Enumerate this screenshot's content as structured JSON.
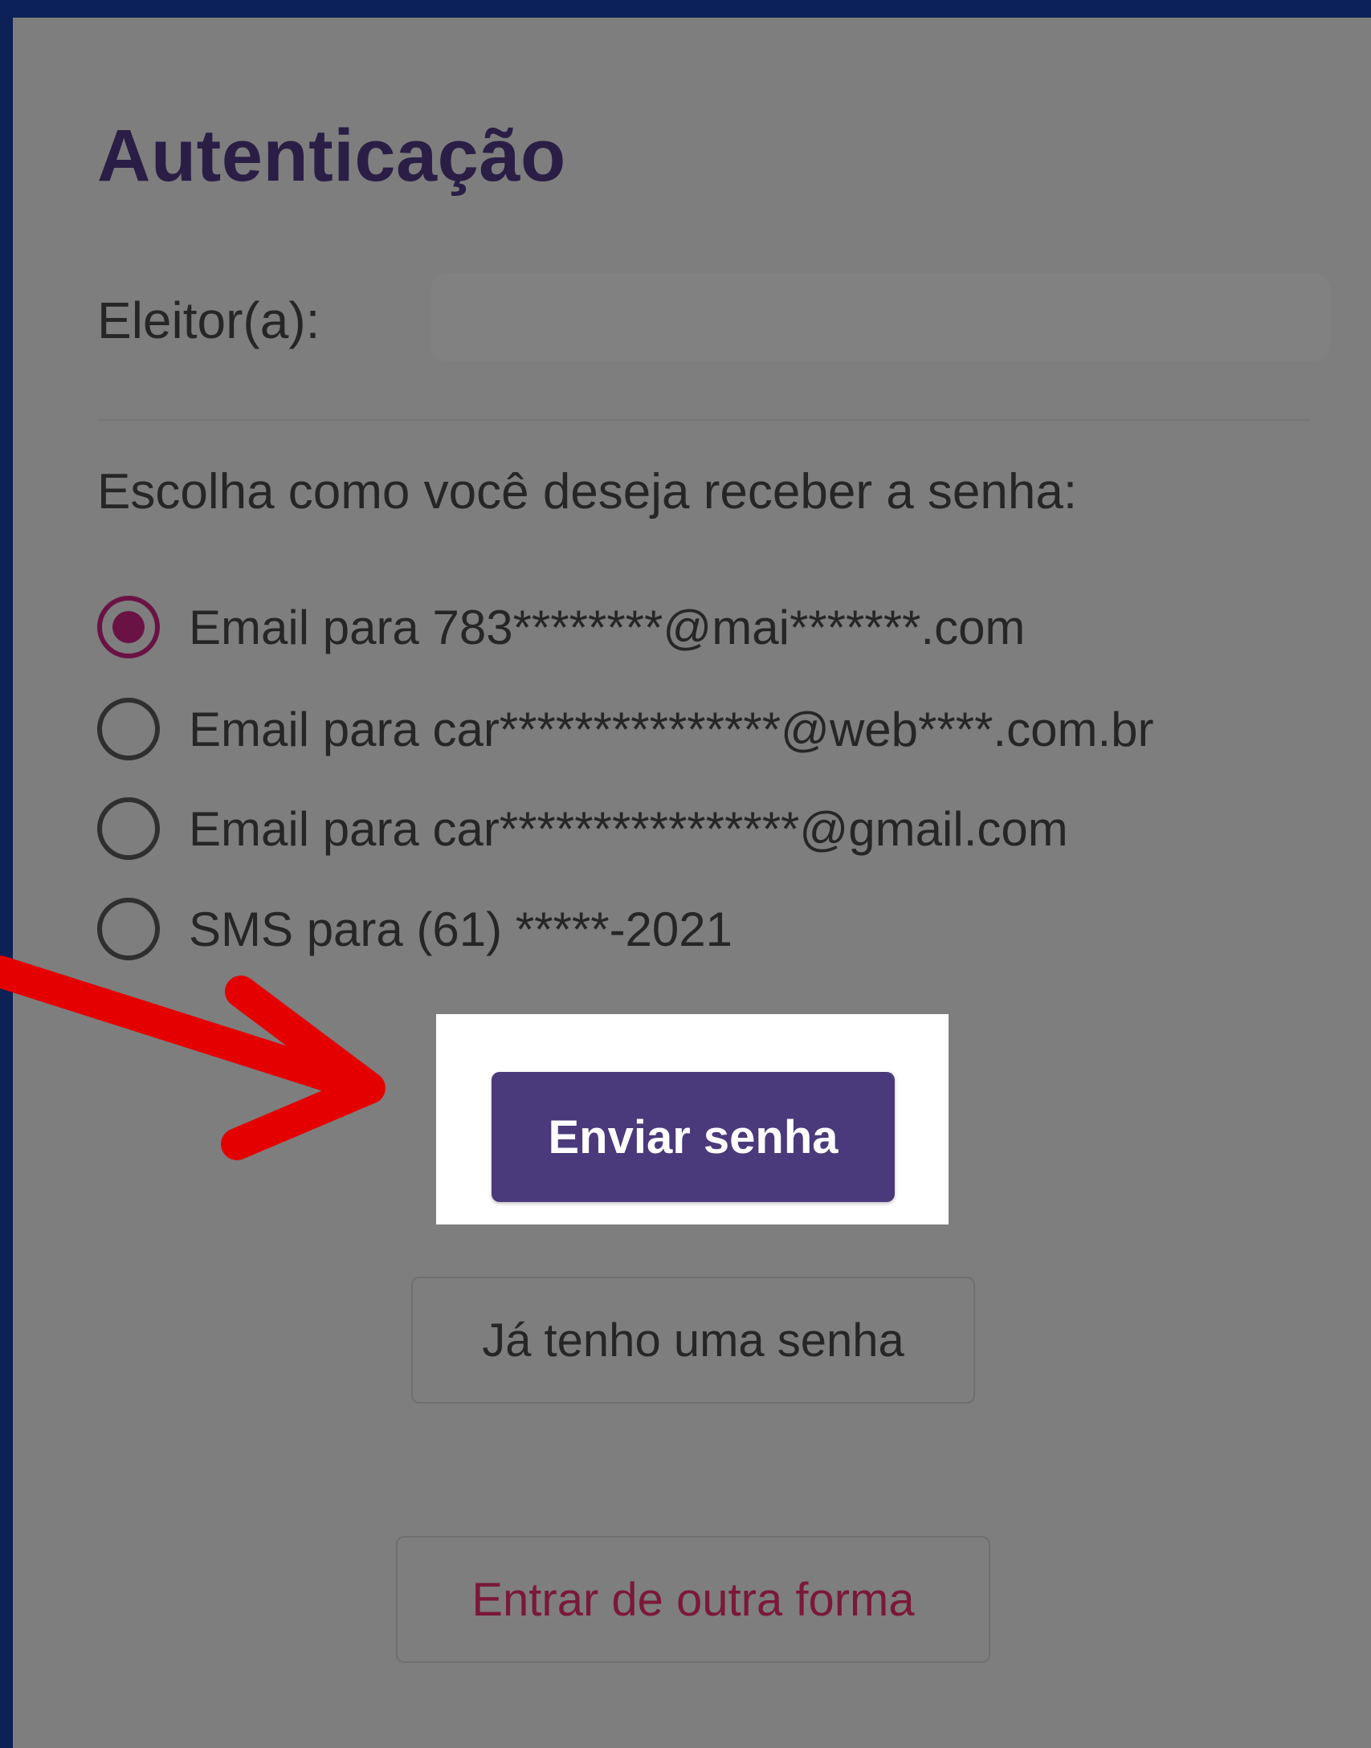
{
  "auth": {
    "title": "Autenticação",
    "voter_label": "Eleitor(a):",
    "prompt": "Escolha como você deseja receber a senha:",
    "options": [
      {
        "label": "Email para 783********@mai*******.com",
        "checked": true
      },
      {
        "label": "Email para car***************@web****.com.br",
        "checked": false
      },
      {
        "label": "Email para car****************@gmail.com",
        "checked": false
      },
      {
        "label": "SMS para (61) *****-2021",
        "checked": false
      }
    ],
    "send_button": "Enviar senha",
    "have_password_button": "Já tenho uma senha",
    "other_login_button": "Entrar de outra forma"
  },
  "colors": {
    "background": "#0b2158",
    "panel": "#7e7e7e",
    "title": "#2a1e46",
    "primary_button": "#4a3a7b",
    "radio_selected": "#6b1244",
    "alt_button_text": "#7b1838",
    "arrow": "#e40000"
  },
  "icons": {
    "arrow": "red-arrow-pointing-right"
  }
}
